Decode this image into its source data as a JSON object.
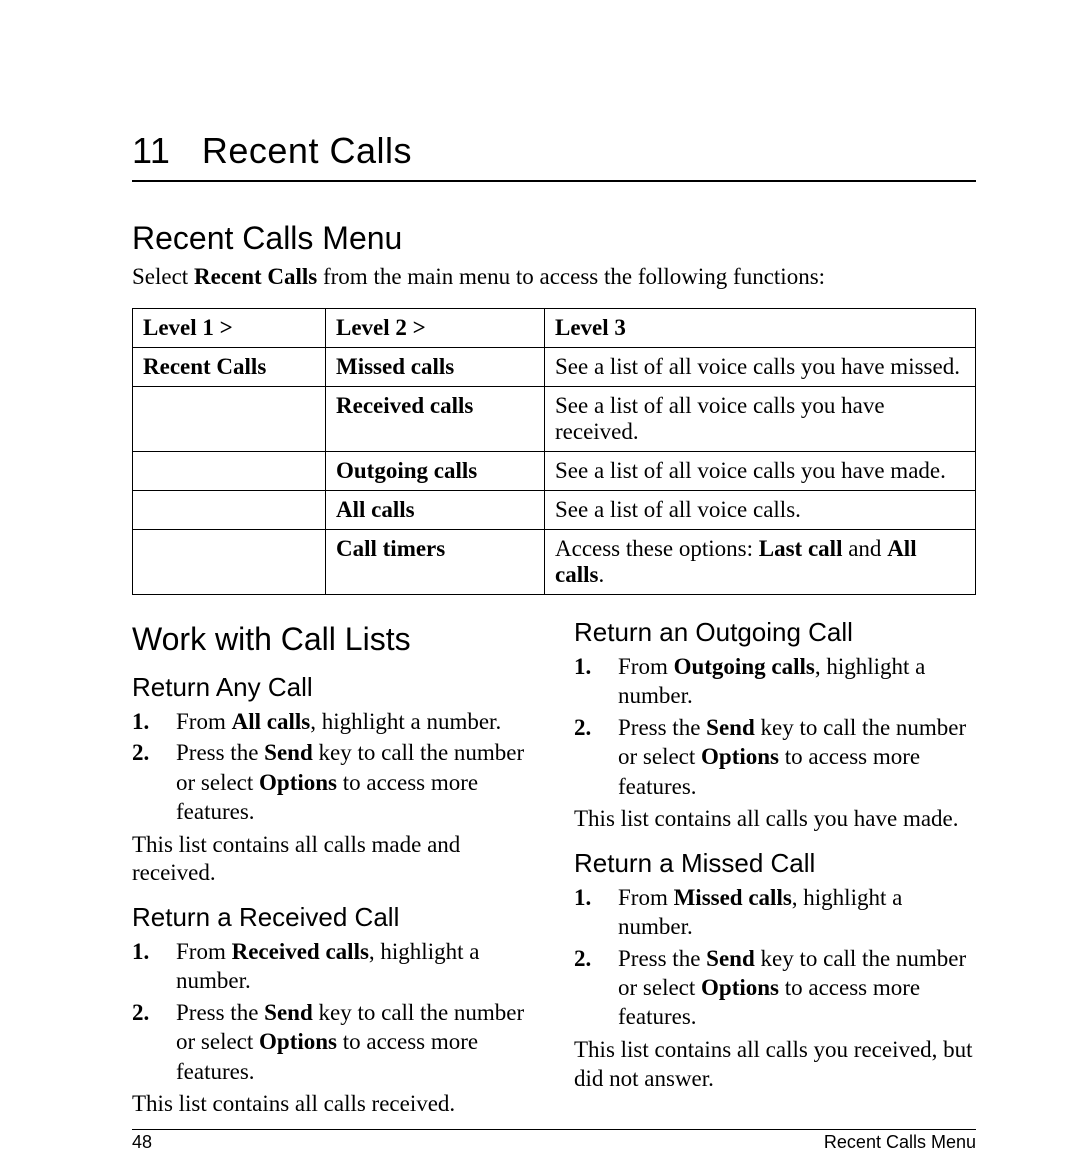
{
  "chapter": {
    "number": "11",
    "title": "Recent Calls"
  },
  "section1": {
    "title": "Recent Calls Menu",
    "intro_pre": "Select ",
    "intro_bold": "Recent Calls",
    "intro_post": " from the main menu to access the following functions:"
  },
  "table": {
    "headers": {
      "c1": "Level 1 >",
      "c2": "Level 2 >",
      "c3": "Level 3"
    },
    "rows": [
      {
        "c1": "Recent Calls",
        "c2": "Missed calls",
        "c3": "See a list of all voice calls you have missed."
      },
      {
        "c1": "",
        "c2": "Received calls",
        "c3": "See a list of all voice calls you have received."
      },
      {
        "c1": "",
        "c2": "Outgoing calls",
        "c3": "See a list of all voice calls you have made."
      },
      {
        "c1": "",
        "c2": "All calls",
        "c3": "See a list of all voice calls."
      },
      {
        "c1": "",
        "c2": "Call timers",
        "c3_pre": "Access these options: ",
        "c3_b1": "Last call",
        "c3_mid": " and ",
        "c3_b2": "All calls",
        "c3_post": "."
      }
    ]
  },
  "section2": {
    "title": "Work with Call Lists"
  },
  "anycall": {
    "title": "Return Any Call",
    "s1_pre": "From ",
    "s1_b": "All calls",
    "s1_post": ", highlight a number.",
    "s2_pre": "Press the ",
    "s2_b1": "Send",
    "s2_mid": " key to call the number or select ",
    "s2_b2": "Options",
    "s2_post": " to access more features.",
    "note": "This list contains all calls made and received."
  },
  "recv": {
    "title": "Return a Received Call",
    "s1_pre": "From ",
    "s1_b": "Received calls",
    "s1_post": ", highlight a number.",
    "s2_pre": "Press the ",
    "s2_b1": "Send",
    "s2_mid": " key to call the number or select ",
    "s2_b2": "Options",
    "s2_post": " to access more features.",
    "note": "This list contains all calls received."
  },
  "out": {
    "title": "Return an Outgoing Call",
    "s1_pre": "From ",
    "s1_b": "Outgoing calls",
    "s1_post": ", highlight a number.",
    "s2_pre": "Press the ",
    "s2_b1": "Send",
    "s2_mid": " key to call the number or select ",
    "s2_b2": "Options",
    "s2_post": " to access more features.",
    "note": "This list contains all calls you have made."
  },
  "miss": {
    "title": "Return a Missed Call",
    "s1_pre": "From ",
    "s1_b": "Missed calls",
    "s1_post": ", highlight a number.",
    "s2_pre": "Press the ",
    "s2_b1": "Send",
    "s2_mid": " key to call the number or select ",
    "s2_b2": "Options",
    "s2_post": " to access more features.",
    "note": "This list contains all calls you received, but did not answer."
  },
  "footer": {
    "page": "48",
    "section": "Recent Calls Menu"
  }
}
